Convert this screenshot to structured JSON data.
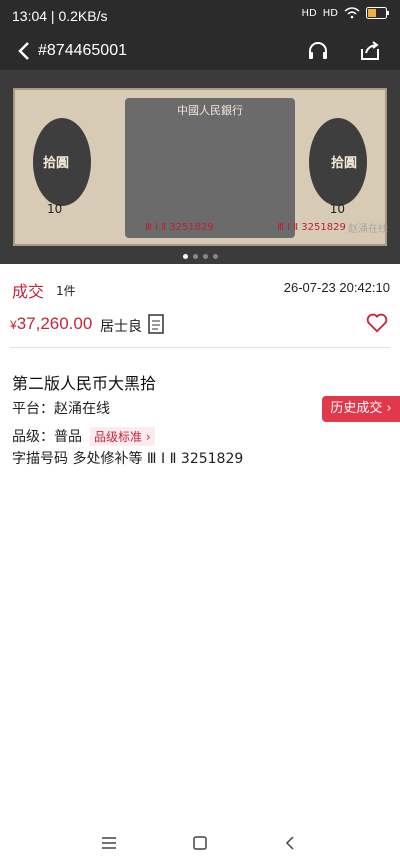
{
  "status_bar": {
    "time": "13:04 | 0.2KB/s",
    "signal": "HD",
    "battery": "",
    "colors": {
      "background": "#2b2b2b",
      "text": "#ffffff"
    }
  },
  "nav": {
    "title": "#874465001",
    "back_icon": "back-icon",
    "support_icon": "headset-icon",
    "share_icon": "share-icon"
  },
  "banner": {
    "header": "中國人民銀行",
    "denomination": "拾圓",
    "serial": "Ⅲ Ⅰ Ⅱ 3251829",
    "number_left": "10",
    "number_right": "10",
    "watermark": "赵涌在线",
    "dots": [
      true,
      false,
      false,
      false
    ]
  },
  "item": {
    "status": "成交",
    "quantity": "1件",
    "time": "26-07-23 20:42:10",
    "price_symbol": "¥",
    "price": "37,260.00",
    "seller": "居士良",
    "name": "第二版人民币大黑拾",
    "platform_label": "平台：赵涌在线",
    "grade_label": "品级：普品",
    "grade_link": "品级标准",
    "description": "字描号码 多处修补等 Ⅲ Ⅰ Ⅱ 3251829",
    "history_button": "历史成交"
  },
  "colors": {
    "accent": "#c7253c",
    "button": "#e2384c"
  }
}
